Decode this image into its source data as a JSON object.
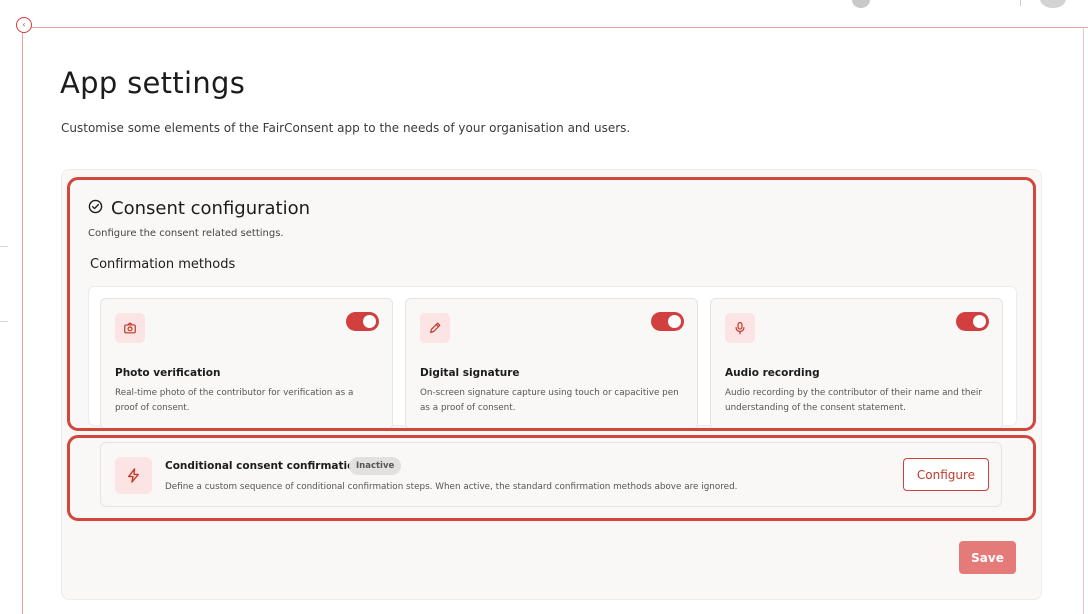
{
  "page": {
    "title": "App settings",
    "subtitle": "Customise some elements of the FairConsent app to the needs of your organisation and users."
  },
  "consent_section": {
    "title": "Consent configuration",
    "description": "Configure the consent related settings.",
    "icon": "check-circle-icon",
    "group_title": "Confirmation methods",
    "methods": [
      {
        "name": "Photo verification",
        "description": "Real-time photo of the contributor for verification as a proof of consent.",
        "icon": "camera-icon",
        "enabled": true
      },
      {
        "name": "Digital signature",
        "description": "On-screen signature capture using touch or capacitive pen as a proof of consent.",
        "icon": "pen-icon",
        "enabled": true
      },
      {
        "name": "Audio recording",
        "description": "Audio recording by the contributor of their name and their understanding of the consent statement.",
        "icon": "microphone-icon",
        "enabled": true
      }
    ]
  },
  "conditional": {
    "title": "Conditional consent confirmation",
    "badge": "Inactive",
    "description": "Define a custom sequence of conditional confirmation steps. When active, the standard confirmation methods above are ignored.",
    "icon": "lightning-icon",
    "button_label": "Configure"
  },
  "footer": {
    "save_label": "Save"
  },
  "colors": {
    "accent": "#d13f3f",
    "highlight_outline": "#d2473d",
    "icon_tile_bg": "#fbe4e3",
    "save_button_bg": "#e57b79",
    "panel_bg": "#f9f8f7"
  }
}
